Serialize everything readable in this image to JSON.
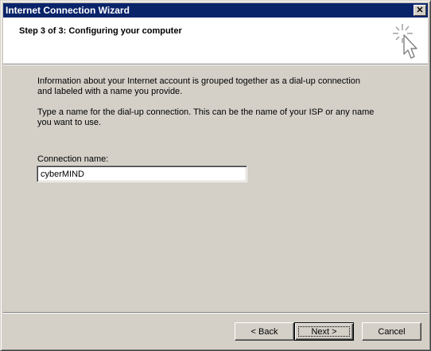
{
  "window": {
    "title": "Internet Connection Wizard",
    "close_glyph": "✕"
  },
  "header": {
    "step_title": "Step 3 of 3: Configuring your computer",
    "icon": "wizard-sparkle-cursor-icon"
  },
  "content": {
    "paragraph1_line1": "Information about your Internet account is grouped together as a dial-up connection",
    "paragraph1_line2": "and labeled with a name you provide.",
    "paragraph2_line1": "Type a name for the dial-up connection. This can be the name of your ISP or any name",
    "paragraph2_line2": "you want to use.",
    "connection_label": "Connection name:",
    "connection_value": "cyberMIND"
  },
  "buttons": {
    "back": "< Back",
    "next": "Next >",
    "cancel": "Cancel"
  },
  "colors": {
    "titlebar": "#0a246a",
    "face": "#d4d0c8"
  }
}
